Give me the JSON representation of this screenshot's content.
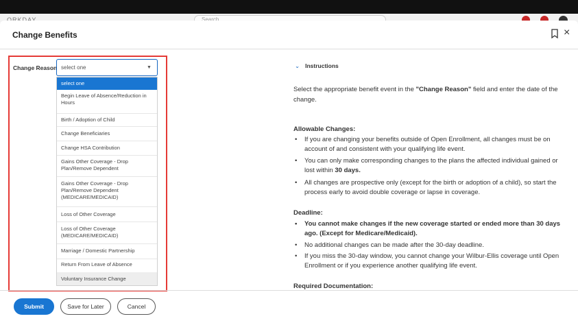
{
  "background": {
    "logo_text": "ORKDAY",
    "search_placeholder": "Search",
    "colors": {
      "topbar": "#111111",
      "notification": "#c62828"
    }
  },
  "modal": {
    "title": "Change Benefits"
  },
  "form": {
    "change_reason_label": "Change Reason",
    "required_marker": "*",
    "select_value": "select one",
    "options": [
      "select one",
      "Begin Leave of Absence/Reduction in Hours",
      "Birth / Adoption of Child",
      "Change Beneficiaries",
      "Change HSA Contribution",
      "Gains Other Coverage - Drop Plan/Remove Dependent",
      "Gains Other Coverage - Drop Plan/Remove Dependent (MEDICARE/MEDICAID)",
      "Loss of Other Coverage",
      "Loss of Other Coverage (MEDICARE/MEDICAID)",
      "Marriage / Domestic Partnership",
      "Return From Leave of Absence",
      "Voluntary Insurance Change"
    ],
    "selected_index": 0,
    "hovered_index": 11
  },
  "instructions": {
    "heading": "Instructions",
    "intro_pre": "Select the appropriate benefit event in the ",
    "intro_bold": "\"Change Reason\"",
    "intro_post": " field and enter the date of the change.",
    "allowable_heading": "Allowable Changes:",
    "allowable_1": "If you are changing your benefits outside of Open Enrollment, all changes must be on account of and consistent with your qualifying life event.",
    "allowable_2_pre": "You can only make corresponding changes to the plans the affected individual gained or lost within ",
    "allowable_2_bold": "30 days.",
    "allowable_3": "All changes are prospective only (except for the birth or adoption of a child), so start the process early to avoid double coverage or lapse in coverage.",
    "deadline_heading": "Deadline:",
    "deadline_1": "You cannot make changes if the new coverage started or ended more than 30 days ago. (Except for Medicare/Medicaid).",
    "deadline_2": "No additional changes can be made after the 30-day deadline.",
    "deadline_3": "If you miss the 30-day window, you cannot change your Wilbur-Ellis coverage until Open Enrollment or if you experience another qualifying life event.",
    "required_doc_heading": "Required Documentation:"
  },
  "footer": {
    "submit": "Submit",
    "save_for_later": "Save for Later",
    "cancel": "Cancel"
  },
  "colors": {
    "accent": "#1976d2",
    "highlight_box": "#e53935"
  }
}
